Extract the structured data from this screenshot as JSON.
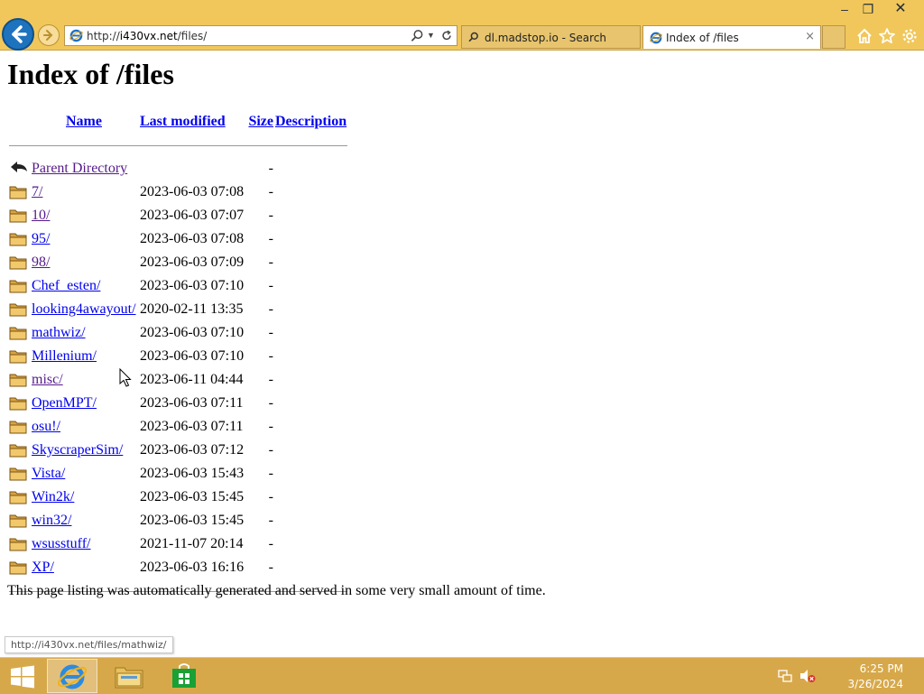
{
  "window": {
    "minimize_glyph": "‒",
    "restore_glyph": "❐",
    "close_glyph": "✕"
  },
  "browser": {
    "address_prefix": "http://",
    "address_host": "i430vx.net",
    "address_path": "/files/",
    "tabs": [
      {
        "label": "dl.madstop.io - Search",
        "icon": "search-icon",
        "active": false
      },
      {
        "label": "Index of /files",
        "icon": "ie-icon",
        "active": true
      }
    ],
    "tab_close_glyph": "×"
  },
  "page": {
    "title": "Index of /files",
    "columns": {
      "name": "Name",
      "last_modified": "Last modified",
      "size": "Size",
      "description": "Description"
    },
    "parent": {
      "name": "Parent Directory",
      "size": "-",
      "icon": "back-arrow-icon"
    },
    "entries": [
      {
        "name": "7/",
        "modified": "2023-06-03 07:08",
        "size": "-",
        "visited": true
      },
      {
        "name": "10/",
        "modified": "2023-06-03 07:07",
        "size": "-",
        "visited": true
      },
      {
        "name": "95/",
        "modified": "2023-06-03 07:08",
        "size": "-",
        "visited": false
      },
      {
        "name": "98/",
        "modified": "2023-06-03 07:09",
        "size": "-",
        "visited": true
      },
      {
        "name": "Chef_esten/",
        "modified": "2023-06-03 07:10",
        "size": "-",
        "visited": false
      },
      {
        "name": "looking4awayout/",
        "modified": "2020-02-11 13:35",
        "size": "-",
        "visited": false
      },
      {
        "name": "mathwiz/",
        "modified": "2023-06-03 07:10",
        "size": "-",
        "visited": false
      },
      {
        "name": "Millenium/",
        "modified": "2023-06-03 07:10",
        "size": "-",
        "visited": false
      },
      {
        "name": "misc/",
        "modified": "2023-06-11 04:44",
        "size": "-",
        "visited": true
      },
      {
        "name": "OpenMPT/",
        "modified": "2023-06-03 07:11",
        "size": "-",
        "visited": false
      },
      {
        "name": "osu!/",
        "modified": "2023-06-03 07:11",
        "size": "-",
        "visited": false
      },
      {
        "name": "SkyscraperSim/",
        "modified": "2023-06-03 07:12",
        "size": "-",
        "visited": false
      },
      {
        "name": "Vista/",
        "modified": "2023-06-03 15:43",
        "size": "-",
        "visited": false
      },
      {
        "name": "Win2k/",
        "modified": "2023-06-03 15:45",
        "size": "-",
        "visited": false
      },
      {
        "name": "win32/",
        "modified": "2023-06-03 15:45",
        "size": "-",
        "visited": false
      },
      {
        "name": "wsusstuff/",
        "modified": "2021-11-07 20:14",
        "size": "-",
        "visited": false
      },
      {
        "name": "XP/",
        "modified": "2023-06-03 16:16",
        "size": "-",
        "visited": false
      }
    ],
    "footer": "This page listing was automatically generated and served in some very small amount of time."
  },
  "status_bar": {
    "hover_url": "http://i430vx.net/files/mathwiz/"
  },
  "taskbar": {
    "time": "6:25 PM",
    "date": "3/26/2024",
    "pinned": [
      "ie-icon",
      "file-explorer-icon",
      "store-icon"
    ]
  },
  "colors": {
    "chrome": "#f1c75b",
    "taskbar": "#d7a84a",
    "link": "#0000ee",
    "visited_link": "#551a8b"
  }
}
